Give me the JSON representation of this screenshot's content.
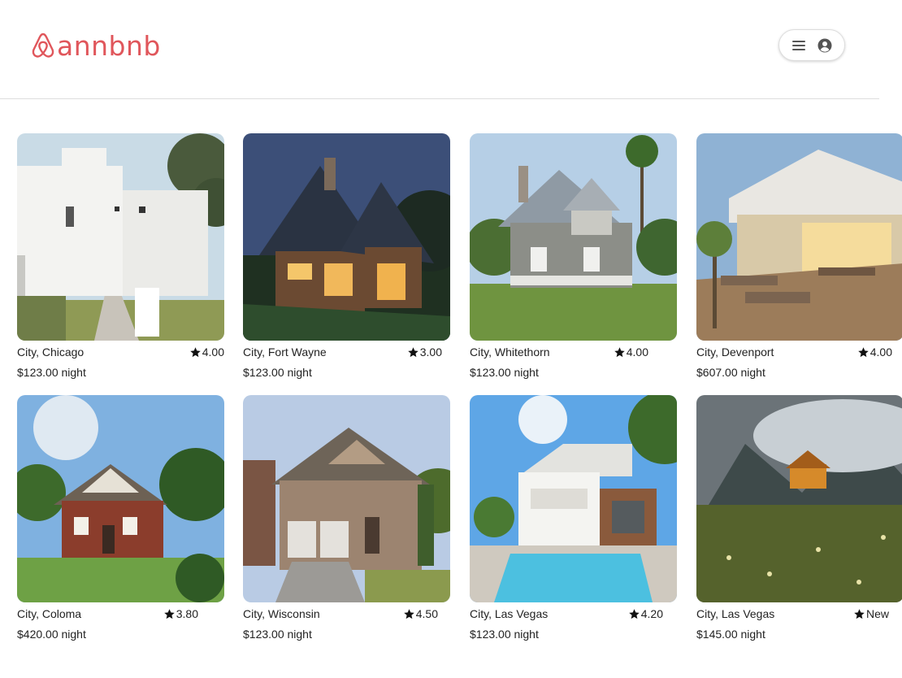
{
  "header": {
    "logo_text": "annbnb",
    "brand_color": "#e0565b",
    "menu_icon": "hamburger-menu-icon",
    "account_icon": "user-circle-icon"
  },
  "listings": [
    {
      "city": "City, Chicago",
      "rating": "4.00",
      "price": "$123.00 night"
    },
    {
      "city": "City, Fort Wayne",
      "rating": "3.00",
      "price": "$123.00 night"
    },
    {
      "city": "City, Whitethorn",
      "rating": "4.00",
      "price": "$123.00 night"
    },
    {
      "city": "City, Devenport",
      "rating": "4.00",
      "price": "$607.00 night"
    },
    {
      "city": "City, Coloma",
      "rating": "3.80",
      "price": "$420.00 night"
    },
    {
      "city": "City, Wisconsin",
      "rating": "4.50",
      "price": "$123.00 night"
    },
    {
      "city": "City, Las Vegas",
      "rating": "4.20",
      "price": "$123.00 night"
    },
    {
      "city": "City, Las Vegas",
      "rating": "New",
      "price": "$145.00 night"
    }
  ]
}
